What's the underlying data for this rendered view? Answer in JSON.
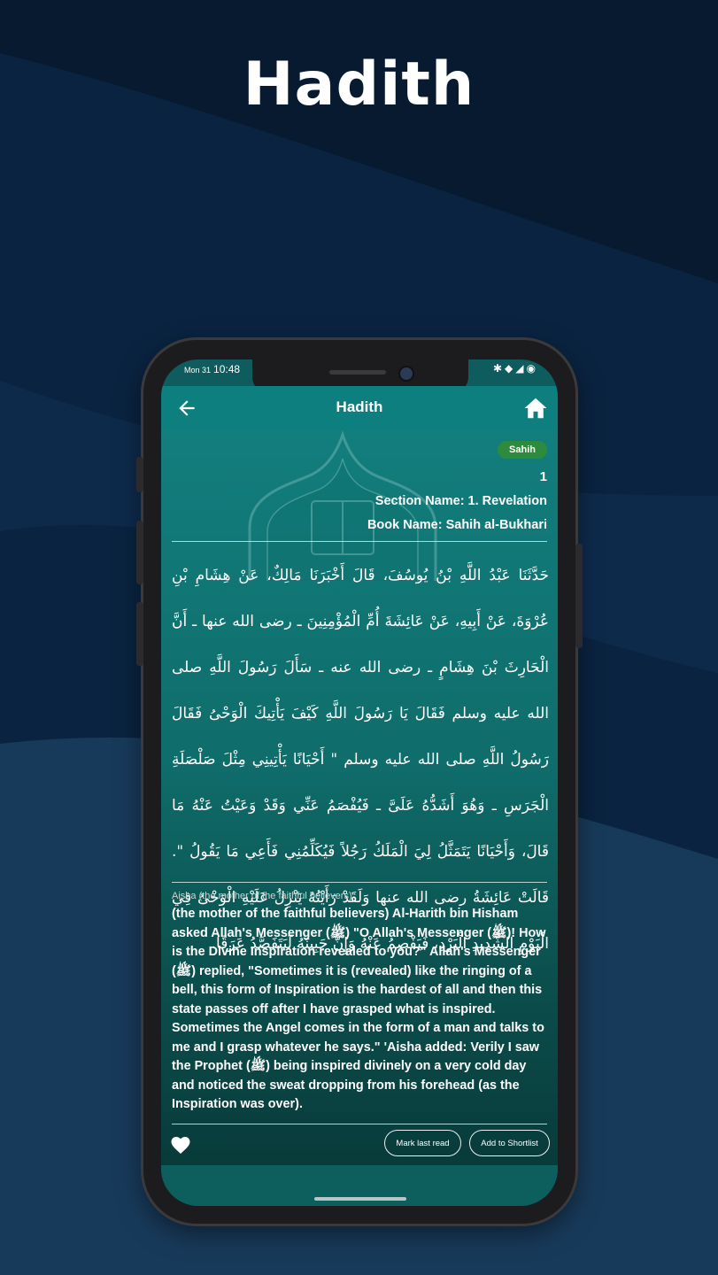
{
  "promo": {
    "title": "Hadith"
  },
  "status_bar": {
    "day": "Mon 31",
    "time": "10:48",
    "icons": [
      "notification-icon",
      "settings-icon",
      "wifi-icon",
      "signal-icon",
      "battery-icon"
    ]
  },
  "app_bar": {
    "title": "Hadith",
    "back_icon": "arrow-left-icon",
    "home_icon": "home-icon"
  },
  "hadith": {
    "grade": "Sahih",
    "number": "1",
    "section": "Section Name: 1. Revelation",
    "book": "Book Name: Sahih al-Bukhari",
    "arabic": "حَدَّثَنَا عَبْدُ اللَّهِ بْنُ يُوسُفَ، قَالَ أَخْبَرَنَا مَالِكٌ، عَنْ هِشَامِ بْنِ عُرْوَةَ، عَنْ أَبِيهِ، عَنْ عَائِشَةَ أُمِّ الْمُؤْمِنِينَ ـ رضى الله عنها ـ أَنَّ الْحَارِثَ بْنَ هِشَامٍ ـ رضى الله عنه ـ سَأَلَ رَسُولَ اللَّهِ صلى الله عليه وسلم فَقَالَ يَا رَسُولَ اللَّهِ كَيْفَ يَأْتِيكَ الْوَحْىُ فَقَالَ رَسُولُ اللَّهِ صلى الله عليه وسلم \" أَحْيَانًا يَأْتِينِي مِثْلَ صَلْصَلَةِ الْجَرَسِ ـ وَهُوَ أَشَدُّهُ عَلَىَّ ـ فَيُفْصَمُ عَنِّي وَقَدْ وَعَيْتُ عَنْهُ مَا قَالَ، وَأَحْيَانًا يَتَمَثَّلُ لِيَ الْمَلَكُ رَجُلاً فَيُكَلِّمُنِي فَأَعِي مَا يَقُولُ \". قَالَتْ عَائِشَةُ رضى الله عنها وَلَقَدْ رَأَيْتُهُ يَنْزِلُ عَلَيْهِ الْوَحْىُ فِي الْيَوْمِ الشَّدِيدِ الْبَرْدِ، فَيَفْصِمُ عَنْهُ وَإِنَّ جَبِينَهُ لَيَتَفَصَّدُ عَرَقًا.",
    "narrator": "Aisha (the mother of the faithful believers)",
    "english": "(the mother of the faithful believers) Al-Harith bin Hisham asked Allah's Messenger (ﷺ) \"O Allah's Messenger (ﷺ)! How is the Divine Inspiration revealed to you?\" Allah's Messenger (ﷺ) replied, \"Sometimes it is (revealed) like the ringing of a bell, this form of Inspiration is the hardest of all and then this state passes off after I have grasped what is inspired. Sometimes the Angel comes in the form of a man and talks to me and I grasp whatever he says.\" 'Aisha added: Verily I saw the Prophet (ﷺ) being inspired divinely on a very cold day and noticed the sweat dropping from his forehead (as the Inspiration was over)."
  },
  "actions": {
    "favorite_icon": "heart-icon",
    "mark_last_read": "Mark last read",
    "add_to_shortlist": "Add to Shortlist"
  }
}
